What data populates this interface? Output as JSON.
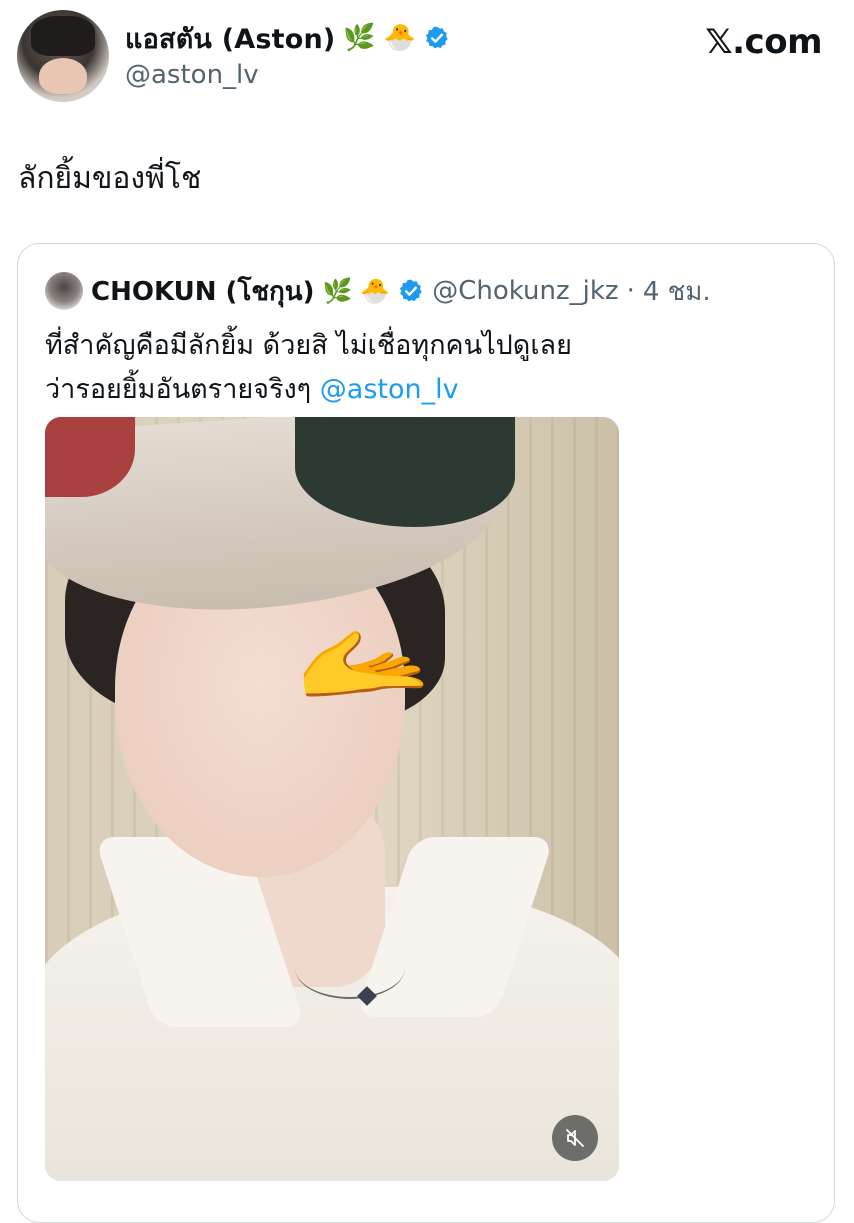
{
  "author": {
    "display_name": "แอสตัน (Aston)",
    "emoji_1": "🌿",
    "emoji_2": "🐣",
    "handle": "@aston_lv",
    "verified_color": "#1d9bf0"
  },
  "brand": "𝕏.com",
  "tweet": {
    "text": "ลักยิ้มของพี่โช"
  },
  "quoted": {
    "display_name": "CHOKUN (โชกุน)",
    "emoji_1": "🌿",
    "emoji_2": "🐣",
    "handle": "@Chokunz_jkz",
    "separator": "·",
    "time": "4 ชม.",
    "text_line_1": "ที่สำคัญคือมีลักยิ้ม ด้วยสิ ไม่เชื่อทุกคนไปดูเลย",
    "text_line_2": "ว่ารอยยิ้มอันตรายจริงๆ",
    "mention": "@aston_lv",
    "media_overlay_emoji": "🫴",
    "mute_icon": "muted-speaker-icon"
  }
}
